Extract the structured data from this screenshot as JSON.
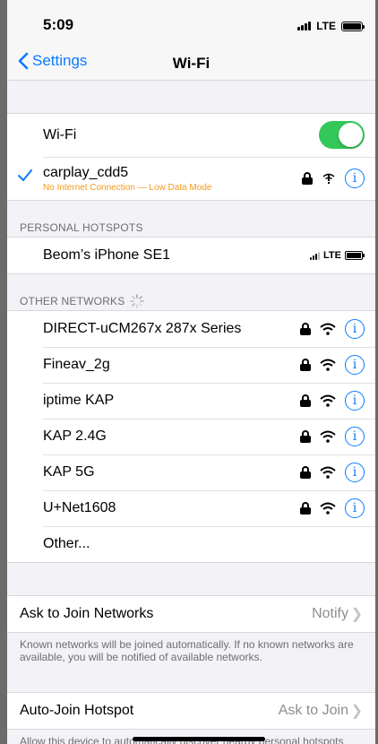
{
  "status_bar": {
    "time": "5:09",
    "network": "LTE"
  },
  "nav": {
    "back_label": "Settings",
    "title": "Wi-Fi"
  },
  "wifi": {
    "label": "Wi-Fi",
    "enabled": true,
    "connected": {
      "name": "carplay_cdd5",
      "subtitle": "No Internet Connection — Low Data Mode"
    }
  },
  "personal_hotspots": {
    "header": "PERSONAL HOTSPOTS",
    "items": [
      {
        "name": "Beom’s iPhone SE1",
        "network": "LTE"
      }
    ]
  },
  "other_networks": {
    "header": "OTHER NETWORKS",
    "items": [
      {
        "name": "DIRECT-uCM267x 287x Series"
      },
      {
        "name": "Fineav_2g"
      },
      {
        "name": "iptime KAP"
      },
      {
        "name": "KAP 2.4G"
      },
      {
        "name": "KAP 5G"
      },
      {
        "name": "U+Net1608"
      }
    ],
    "other_label": "Other..."
  },
  "ask_to_join": {
    "label": "Ask to Join Networks",
    "value": "Notify",
    "footer": "Known networks will be joined automatically. If no known networks are available, you will be notified of available networks."
  },
  "auto_join": {
    "label": "Auto-Join Hotspot",
    "value": "Ask to Join",
    "footer": "Allow this device to automatically discover nearby personal hotspots when no Wi-Fi network is available."
  },
  "colors": {
    "accent": "#0a7aff",
    "toggle_on": "#34c759",
    "warning": "#f29a1d"
  }
}
